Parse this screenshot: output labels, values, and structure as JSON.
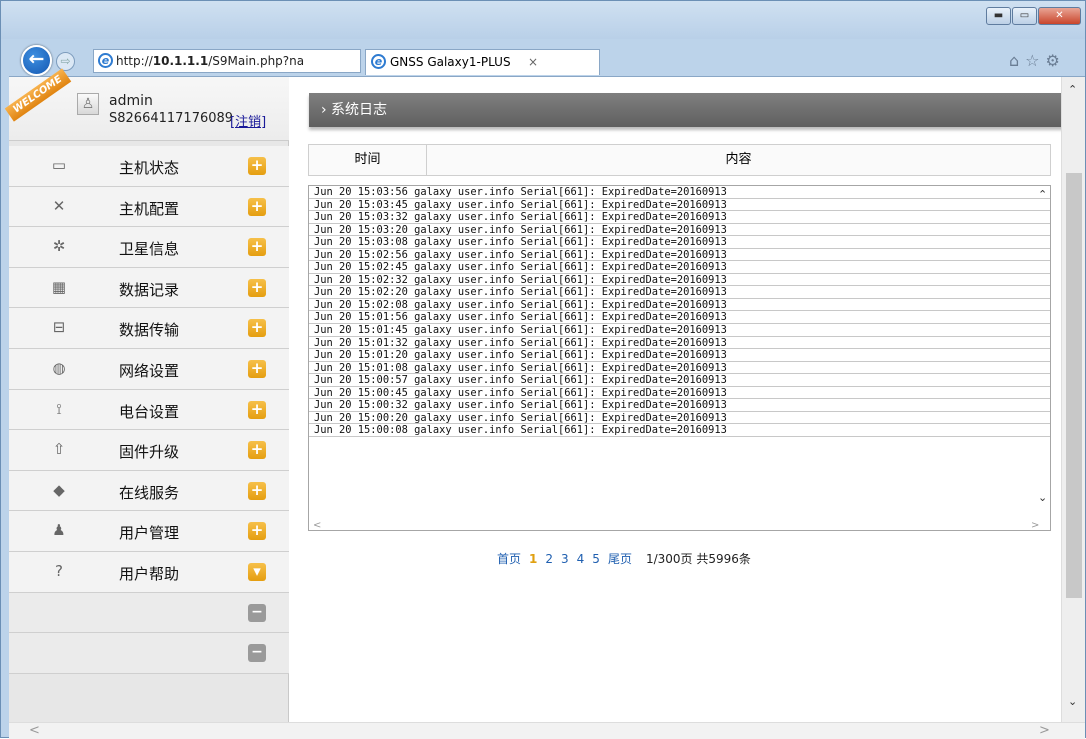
{
  "window": {
    "btn_min": "▬",
    "btn_max": "▭",
    "btn_close": "✕"
  },
  "nav": {
    "back_glyph": "←",
    "fwd_glyph": "⇨",
    "url_prefix": "http://",
    "url_host": "10.1.1.1",
    "url_path": "/S9Main.php?na",
    "addr_tools": "⌕▾ ↻",
    "tab_title": "GNSS Galaxy1-PLUS",
    "tab_close": "×",
    "right_icons": "⌂☆⚙"
  },
  "user": {
    "welcome": "WELCOME",
    "name": "admin",
    "serial": "S82664117176089",
    "logout": "[注销]"
  },
  "menu": [
    {
      "label": "主机状态",
      "icon": "monitor-icon",
      "glyph": "▭",
      "btn": "+"
    },
    {
      "label": "主机配置",
      "icon": "tools-icon",
      "glyph": "✕",
      "btn": "+"
    },
    {
      "label": "卫星信息",
      "icon": "satellite-icon",
      "glyph": "✲",
      "btn": "+"
    },
    {
      "label": "数据记录",
      "icon": "calendar-icon",
      "glyph": "▦",
      "btn": "+"
    },
    {
      "label": "数据传输",
      "icon": "network-icon",
      "glyph": "⊟",
      "btn": "+"
    },
    {
      "label": "网络设置",
      "icon": "globe-icon",
      "glyph": "◍",
      "btn": "+"
    },
    {
      "label": "电台设置",
      "icon": "radio-icon",
      "glyph": "⟟",
      "btn": "+"
    },
    {
      "label": "固件升级",
      "icon": "upload-icon",
      "glyph": "⇧",
      "btn": "+"
    },
    {
      "label": "在线服务",
      "icon": "cube-icon",
      "glyph": "◆",
      "btn": "+"
    },
    {
      "label": "用户管理",
      "icon": "users-icon",
      "glyph": "♟",
      "btn": "+"
    },
    {
      "label": "用户帮助",
      "icon": "help-icon",
      "glyph": "?",
      "btn": "▾"
    }
  ],
  "menu_blank_btn": "−",
  "breadcrumb": "› 系统日志",
  "table": {
    "col_time": "时间",
    "col_content": "内容"
  },
  "log_lines": [
    "Jun 20 15:03:56 galaxy user.info Serial[661]: ExpiredDate=20160913",
    "Jun 20 15:03:45 galaxy user.info Serial[661]: ExpiredDate=20160913",
    "Jun 20 15:03:32 galaxy user.info Serial[661]: ExpiredDate=20160913",
    "Jun 20 15:03:20 galaxy user.info Serial[661]: ExpiredDate=20160913",
    "Jun 20 15:03:08 galaxy user.info Serial[661]: ExpiredDate=20160913",
    "Jun 20 15:02:56 galaxy user.info Serial[661]: ExpiredDate=20160913",
    "Jun 20 15:02:45 galaxy user.info Serial[661]: ExpiredDate=20160913",
    "Jun 20 15:02:32 galaxy user.info Serial[661]: ExpiredDate=20160913",
    "Jun 20 15:02:20 galaxy user.info Serial[661]: ExpiredDate=20160913",
    "Jun 20 15:02:08 galaxy user.info Serial[661]: ExpiredDate=20160913",
    "Jun 20 15:01:56 galaxy user.info Serial[661]: ExpiredDate=20160913",
    "Jun 20 15:01:45 galaxy user.info Serial[661]: ExpiredDate=20160913",
    "Jun 20 15:01:32 galaxy user.info Serial[661]: ExpiredDate=20160913",
    "Jun 20 15:01:20 galaxy user.info Serial[661]: ExpiredDate=20160913",
    "Jun 20 15:01:08 galaxy user.info Serial[661]: ExpiredDate=20160913",
    "Jun 20 15:00:57 galaxy user.info Serial[661]: ExpiredDate=20160913",
    "Jun 20 15:00:45 galaxy user.info Serial[661]: ExpiredDate=20160913",
    "Jun 20 15:00:32 galaxy user.info Serial[661]: ExpiredDate=20160913",
    "Jun 20 15:00:20 galaxy user.info Serial[661]: ExpiredDate=20160913",
    "Jun 20 15:00:08 galaxy user.info Serial[661]: ExpiredDate=20160913"
  ],
  "pager": {
    "first": "首页",
    "pages": [
      "1",
      "2",
      "3",
      "4",
      "5"
    ],
    "current": "1",
    "last": "尾页",
    "info": "1/300页 共5996条"
  },
  "scroll": {
    "up": "⌃",
    "down": "⌄",
    "left": "<",
    "right": ">"
  }
}
